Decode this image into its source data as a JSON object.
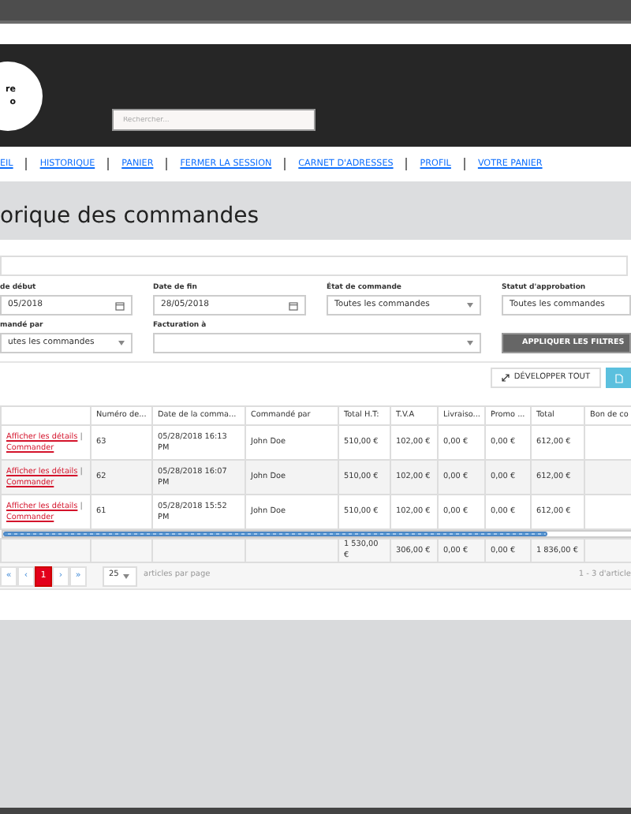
{
  "header": {
    "logo_text": [
      "re",
      "o"
    ],
    "search": {
      "placeholder": "Rechercher..."
    }
  },
  "nav": [
    "EIL",
    "HISTORIQUE",
    "PANIER",
    "FERMER LA SESSION",
    "CARNET D'ADRESSES",
    "PROFIL",
    "VOTRE PANIER"
  ],
  "page_title": "orique des commandes",
  "filters": [
    {
      "label": "de début",
      "value": "05/2018",
      "kind": "date"
    },
    {
      "label": "Date de fin",
      "value": "28/05/2018",
      "kind": "date"
    },
    {
      "label": "État de commande",
      "value": "Toutes les commandes",
      "kind": "select"
    },
    {
      "label": "Statut d'approbation",
      "value": "Toutes les commandes",
      "kind": "text"
    },
    {
      "label": "mandé par",
      "value": "utes les commandes",
      "kind": "select"
    },
    {
      "label": "Facturation à",
      "kind": "select"
    }
  ],
  "apply_button": "APPLIQUER LES FILTRES",
  "expand_button": "DÉVELOPPER TOUT",
  "table": {
    "columns": [
      "Numéro de...",
      "Date de la comma...",
      "Commandé par",
      "Total H.T:",
      "T.V.A",
      "Livraiso...",
      "Promo ...",
      "Total",
      "Bon de co"
    ],
    "rows": [
      {
        "actions": {
          "details": "Afficher les détails",
          "sep": "|",
          "order": "Commander"
        },
        "cells": [
          "63",
          "05/28/2018 16:13 PM",
          "John Doe",
          "510,00 €",
          "102,00 €",
          "0,00 €",
          "0,00 €",
          "612,00 €"
        ]
      },
      {
        "actions": {
          "details": "Afficher les détails",
          "sep": "|",
          "order": "Commander"
        },
        "cells": [
          "62",
          "05/28/2018 16:07 PM",
          "John Doe",
          "510,00 €",
          "102,00 €",
          "0,00 €",
          "0,00 €",
          "612,00 €"
        ]
      },
      {
        "actions": {
          "details": "Afficher les détails",
          "sep": "|",
          "order": "Commander"
        },
        "cells": [
          "61",
          "05/28/2018 15:52 PM",
          "John Doe",
          "510,00 €",
          "102,00 €",
          "0,00 €",
          "0,00 €",
          "612,00 €"
        ]
      }
    ],
    "totals": [
      "1 530,00 €",
      "306,00 €",
      "0,00 €",
      "0,00 €",
      "1 836,00 €"
    ]
  },
  "pagination": {
    "buttons": [
      {
        "label": "«",
        "selected": false
      },
      {
        "label": "‹",
        "selected": false
      },
      {
        "label": "1",
        "selected": true
      },
      {
        "label": "›",
        "selected": false
      },
      {
        "label": "»",
        "selected": false
      }
    ],
    "page_size": "25",
    "page_size_label": "articles par page",
    "range": "1 - 3 d'article"
  }
}
